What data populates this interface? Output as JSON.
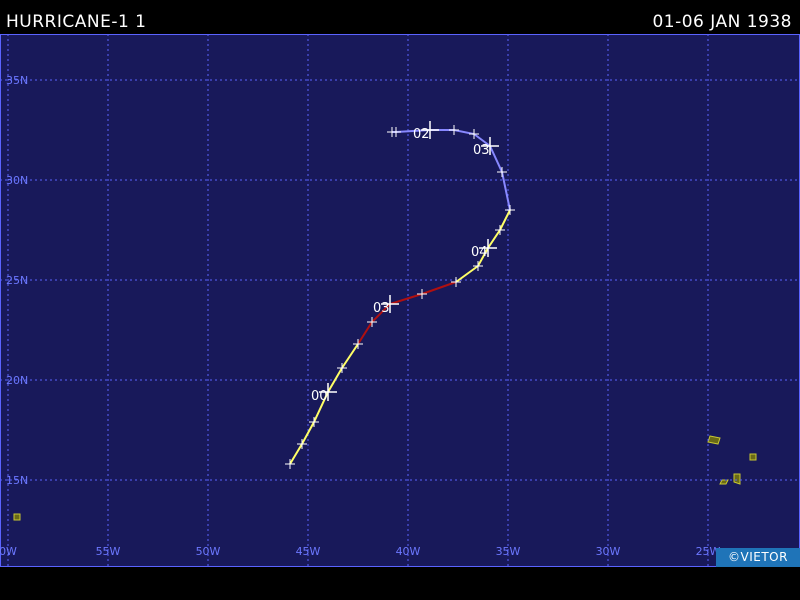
{
  "header": {
    "storm_name": "HURRICANE-1 1",
    "date_range": "01-06 JAN 1938"
  },
  "credit": "©VIETOR",
  "map": {
    "background_color": "#18195a",
    "grid_color": "#5a63ff",
    "label_color": "#6c78ff",
    "lon_range": [
      -60,
      -20
    ],
    "lat_range": [
      12,
      37
    ],
    "lat_labels": [
      {
        "lat": 35,
        "text": "35N"
      },
      {
        "lat": 30,
        "text": "30N"
      },
      {
        "lat": 25,
        "text": "25N"
      },
      {
        "lat": 20,
        "text": "20N"
      },
      {
        "lat": 15,
        "text": "15N"
      }
    ],
    "lon_labels": [
      {
        "lon": -60,
        "text": "0W"
      },
      {
        "lon": -55,
        "text": "55W"
      },
      {
        "lon": -50,
        "text": "50W"
      },
      {
        "lon": -45,
        "text": "45W"
      },
      {
        "lon": -40,
        "text": "40W"
      },
      {
        "lon": -35,
        "text": "35W"
      },
      {
        "lon": -30,
        "text": "30W"
      },
      {
        "lon": -25,
        "text": "25W"
      }
    ]
  },
  "track": {
    "segments": [
      {
        "category": "tropical storm",
        "color": "#ffff66",
        "points": [
          [
            -45.9,
            15.8
          ],
          [
            -45.3,
            16.8
          ],
          [
            -44.7,
            17.9
          ],
          [
            -44.0,
            19.4
          ],
          [
            -43.3,
            20.6
          ],
          [
            -42.5,
            21.8
          ]
        ]
      },
      {
        "category": "hurricane",
        "color": "#b01010",
        "points": [
          [
            -42.5,
            21.8
          ],
          [
            -41.8,
            22.9
          ],
          [
            -40.9,
            23.8
          ],
          [
            -39.3,
            24.3
          ],
          [
            -37.6,
            24.9
          ]
        ]
      },
      {
        "category": "tropical storm",
        "color": "#ffff66",
        "points": [
          [
            -37.6,
            24.9
          ],
          [
            -36.5,
            25.7
          ],
          [
            -36.0,
            26.6
          ],
          [
            -35.4,
            27.5
          ],
          [
            -34.9,
            28.5
          ]
        ]
      },
      {
        "category": "extratropical",
        "color": "#8888ff",
        "points": [
          [
            -34.9,
            28.5
          ],
          [
            -35.3,
            30.4
          ],
          [
            -35.9,
            31.7
          ],
          [
            -36.7,
            32.3
          ],
          [
            -37.7,
            32.5
          ],
          [
            -38.9,
            32.5
          ],
          [
            -40.6,
            32.4
          ],
          [
            -40.8,
            32.4
          ]
        ]
      }
    ],
    "day_markers": [
      {
        "label": "00",
        "lon": -44.0,
        "lat": 19.4
      },
      {
        "label": "03",
        "lon": -40.9,
        "lat": 23.8
      },
      {
        "label": "04",
        "lon": -36.0,
        "lat": 26.6
      },
      {
        "label": "03",
        "lon": -35.9,
        "lat": 31.7
      },
      {
        "label": "02",
        "lon": -38.9,
        "lat": 32.5
      }
    ]
  },
  "land": {
    "color": "#6a6a16",
    "outline_color": "#c8c832",
    "features": [
      {
        "name": "cape verde island",
        "points": [
          [
            -24.9,
            17.2
          ],
          [
            -24.4,
            17.1
          ],
          [
            -24.5,
            16.8
          ],
          [
            -25.0,
            16.9
          ]
        ]
      },
      {
        "name": "cape verde island",
        "points": [
          [
            -22.9,
            16.3
          ],
          [
            -22.6,
            16.3
          ],
          [
            -22.6,
            16.0
          ],
          [
            -22.9,
            16.0
          ]
        ]
      },
      {
        "name": "cape verde island",
        "points": [
          [
            -23.7,
            15.3
          ],
          [
            -23.4,
            15.3
          ],
          [
            -23.4,
            14.8
          ],
          [
            -23.7,
            14.9
          ]
        ]
      },
      {
        "name": "cape verde island",
        "points": [
          [
            -24.3,
            15.0
          ],
          [
            -24.0,
            15.0
          ],
          [
            -24.1,
            14.8
          ],
          [
            -24.4,
            14.8
          ]
        ]
      },
      {
        "name": "cape verde island",
        "points": [
          [
            -59.7,
            13.3
          ],
          [
            -59.4,
            13.3
          ],
          [
            -59.4,
            13.0
          ],
          [
            -59.7,
            13.0
          ]
        ]
      }
    ]
  }
}
